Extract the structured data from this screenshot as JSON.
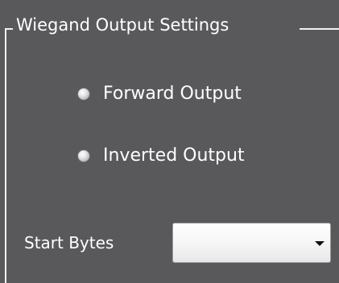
{
  "group": {
    "title": "Wiegand Output Settings"
  },
  "options": [
    {
      "label": "Forward Output",
      "selected": false
    },
    {
      "label": "Inverted Output",
      "selected": false
    }
  ],
  "start_bytes": {
    "label": "Start Bytes",
    "value": ""
  },
  "colors": {
    "background": "#59595c",
    "frame": "#f2f2f2",
    "text": "#ffffff",
    "dropdown": "#f4f4f4"
  },
  "icons": {
    "dropdown": "chevron-down-icon",
    "radio": "radio-button-icon"
  }
}
